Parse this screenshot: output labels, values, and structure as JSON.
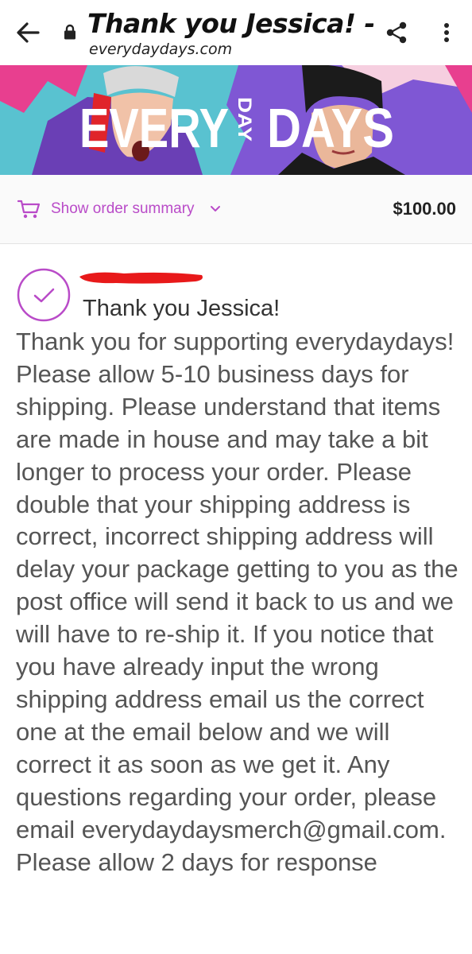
{
  "header": {
    "title": "Thank you Jessica! - ...",
    "url": "everydaydays.com"
  },
  "banner": {
    "brand_left": "EVERY",
    "brand_middle": "DAY",
    "brand_right": "DAYS"
  },
  "order_summary": {
    "toggle_label": "Show order summary",
    "total": "$100.00"
  },
  "confirmation": {
    "title": "Thank you Jessica!",
    "message": "Thank you for supporting everydaydays! Please allow 5-10 business days for shipping. Please understand that items are made in house and may take a bit longer to process your order. Please double that your shipping address is correct, incorrect shipping address will delay your package getting to you as the post office will send it back to us and we will have to re-ship it. If you notice that you have already input the wrong shipping address email us the correct one at the email below and we will correct it as soon as we get it. Any questions regarding your order, please email everydaydaysmerch@gmail.com. Please allow 2 days for response"
  },
  "colors": {
    "accent": "#b94bc8",
    "redaction": "#e8191a"
  }
}
